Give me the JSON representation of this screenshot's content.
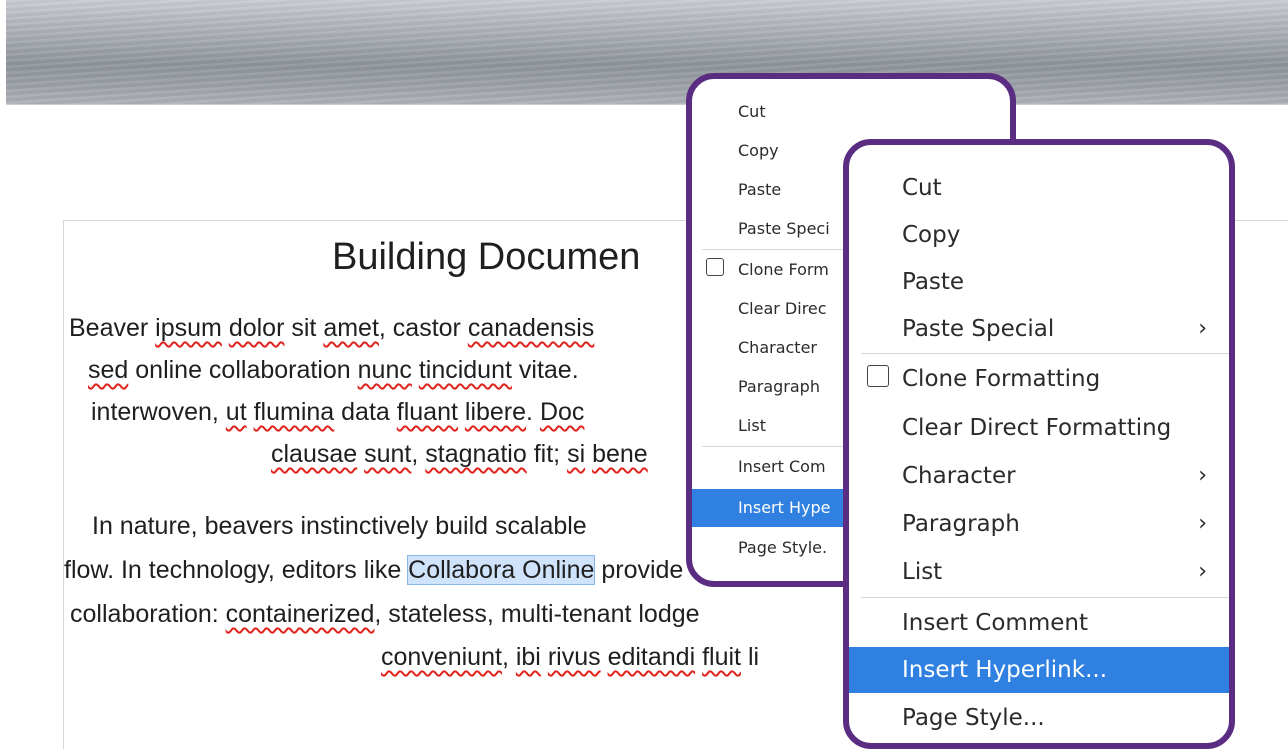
{
  "document": {
    "title": "Building Documen",
    "paragraph1": {
      "line1": [
        {
          "t": "Beaver ",
          "s": false
        },
        {
          "t": "ipsum",
          "s": true
        },
        {
          "t": " ",
          "s": false
        },
        {
          "t": "dolor",
          "s": true
        },
        {
          "t": " sit ",
          "s": false
        },
        {
          "t": "amet",
          "s": true
        },
        {
          "t": ", castor ",
          "s": false
        },
        {
          "t": "canadensis",
          "s": true
        }
      ],
      "line2": [
        {
          "t": "sed",
          "s": true
        },
        {
          "t": " online collaboration ",
          "s": false
        },
        {
          "t": "nunc",
          "s": true
        },
        {
          "t": " ",
          "s": false
        },
        {
          "t": "tincidunt",
          "s": true
        },
        {
          "t": " vitae.",
          "s": false
        }
      ],
      "line3": [
        {
          "t": "interwoven, ",
          "s": false
        },
        {
          "t": "ut",
          "s": true
        },
        {
          "t": " ",
          "s": false
        },
        {
          "t": "flumina",
          "s": true
        },
        {
          "t": " data ",
          "s": false
        },
        {
          "t": "fluant",
          "s": true
        },
        {
          "t": " ",
          "s": false
        },
        {
          "t": "libere",
          "s": true
        },
        {
          "t": ". ",
          "s": false
        },
        {
          "t": "Doc",
          "s": true
        }
      ],
      "line4": [
        {
          "t": "clausae",
          "s": true
        },
        {
          "t": " ",
          "s": false
        },
        {
          "t": "sunt",
          "s": true
        },
        {
          "t": ", ",
          "s": false
        },
        {
          "t": "stagnatio",
          "s": true
        },
        {
          "t": " fit; ",
          "s": false
        },
        {
          "t": "si",
          "s": true
        },
        {
          "t": " ",
          "s": false
        },
        {
          "t": "bene",
          "s": true
        }
      ]
    },
    "paragraph2": {
      "line1": [
        {
          "t": "In nature, beavers instinctively build scalable",
          "s": false
        }
      ],
      "line2_before": "flow. In technology, editors like ",
      "line2_selected": "Collabora Online",
      "line2_after": " provide co",
      "line3": [
        {
          "t": "collaboration: ",
          "s": false
        },
        {
          "t": "containerized",
          "s": true
        },
        {
          "t": ", stateless, multi-tenant lodge",
          "s": false
        }
      ],
      "line4": [
        {
          "t": "conveniunt",
          "s": true
        },
        {
          "t": ", ",
          "s": false
        },
        {
          "t": "ibi",
          "s": true
        },
        {
          "t": " ",
          "s": false
        },
        {
          "t": "rivus",
          "s": true
        },
        {
          "t": " ",
          "s": false
        },
        {
          "t": "editandi",
          "s": true
        },
        {
          "t": " ",
          "s": false
        },
        {
          "t": "fluit",
          "s": true
        },
        {
          "t": " li",
          "s": false
        }
      ]
    }
  },
  "context_menu_small": {
    "items": [
      {
        "label": "Cut"
      },
      {
        "label": "Copy"
      },
      {
        "label": "Paste"
      },
      {
        "label": "Paste Speci"
      },
      {
        "label": "Clone Form"
      },
      {
        "label": "Clear Direc"
      },
      {
        "label": "Character"
      },
      {
        "label": "Paragraph"
      },
      {
        "label": "List"
      },
      {
        "label": "Insert Com"
      },
      {
        "label": "Insert Hype"
      },
      {
        "label": "Page Style."
      }
    ]
  },
  "context_menu_large": {
    "items": [
      {
        "label": "Cut"
      },
      {
        "label": "Copy"
      },
      {
        "label": "Paste"
      },
      {
        "label": "Paste Special"
      },
      {
        "label": "Clone Formatting"
      },
      {
        "label": "Clear Direct Formatting"
      },
      {
        "label": "Character"
      },
      {
        "label": "Paragraph"
      },
      {
        "label": "List"
      },
      {
        "label": "Insert Comment"
      },
      {
        "label": "Insert Hyperlink..."
      },
      {
        "label": "Page Style..."
      }
    ],
    "submenu_glyph": "›"
  },
  "colors": {
    "highlight": "#2f80e0",
    "callout_border": "#5b2d82",
    "spellcheck": "#e0231c",
    "selection": "#cfe3fb"
  }
}
